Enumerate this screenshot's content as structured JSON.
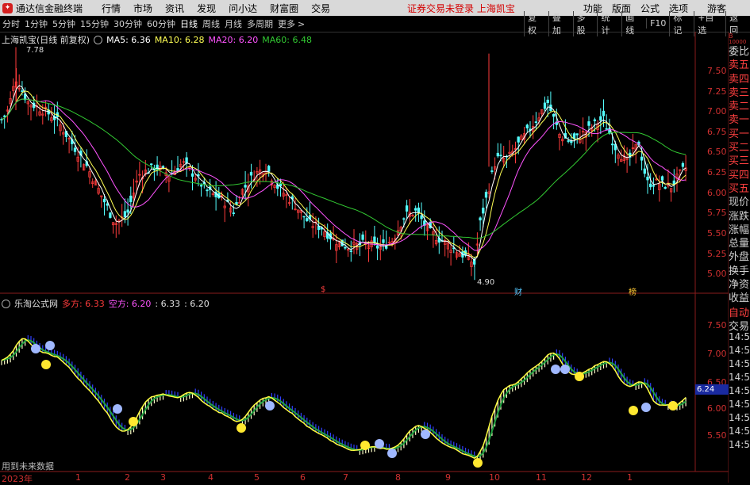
{
  "menubar": {
    "title": "通达信金融终端",
    "items": [
      "行情",
      "市场",
      "资讯",
      "发现",
      "问小达",
      "财富圈",
      "交易"
    ],
    "warning": "证券交易未登录  上海凯宝",
    "right": [
      "功能",
      "版面",
      "公式",
      "选项",
      "游客"
    ]
  },
  "toolbar": {
    "periods": [
      "分时",
      "1分钟",
      "5分钟",
      "15分钟",
      "30分钟",
      "60分钟",
      "日线",
      "周线",
      "月线",
      "多周期",
      "更多"
    ],
    "selected": "日线",
    "more_arrow": ">",
    "right": [
      "复权",
      "叠加",
      "多股",
      "统计",
      "画线",
      "F10",
      "标记",
      "+自选",
      "返回"
    ]
  },
  "main_legend": {
    "name": "上海凯宝(日线 前复权)",
    "ma5": "MA5: 6.36",
    "ma10": "MA10: 6.28",
    "ma20": "MA20: 6.20",
    "ma60": "MA60: 6.48"
  },
  "sub_legend": {
    "name": "乐淘公式网",
    "duo": "多方: 6.33",
    "kong": "空方: 6.20",
    "v1": ": 6.33",
    "v2": ": 6.20"
  },
  "price_axis": [
    "7.50",
    "7.25",
    "7.00",
    "6.75",
    "6.50",
    "6.25",
    "6.00",
    "5.75",
    "5.50",
    "5.25",
    "5.00"
  ],
  "sub_axis": [
    "7.50",
    "7.00",
    "6.50",
    "6.00",
    "5.50"
  ],
  "high_label": "7.78",
  "low_label": "4.90",
  "markers": {
    "s": "$",
    "cai": "财",
    "bang": "榜"
  },
  "sidebar_items": [
    "委比",
    "卖五",
    "卖四",
    "卖三",
    "卖二",
    "卖一",
    "买一",
    "买二",
    "买三",
    "买四",
    "买五",
    "现价",
    "涨跌",
    "涨幅",
    "总量",
    "外盘",
    "换手",
    "净资",
    "收益"
  ],
  "sidebar_top": {
    "a": "B",
    "b": "10000"
  },
  "sidebar_sub": {
    "auto": "自动",
    "trade": "交易",
    "times": [
      "14:56",
      "14:56",
      "14:56",
      "14:56",
      "14:56",
      "14:56",
      "14:56",
      "14:56",
      "14:56"
    ]
  },
  "current_price": "6.24",
  "x_axis": [
    "2023年",
    "1",
    "2",
    "3",
    "4",
    "5",
    "6",
    "7",
    "8",
    "9",
    "10",
    "11",
    "12",
    "1"
  ],
  "footnote": "用到未来数据",
  "colors": {
    "up": "#ff3c3c",
    "down": "#54ffff",
    "ma5": "#ffffff",
    "ma10": "#ffff54",
    "ma20": "#ff54ff",
    "ma60": "#32c832"
  }
}
